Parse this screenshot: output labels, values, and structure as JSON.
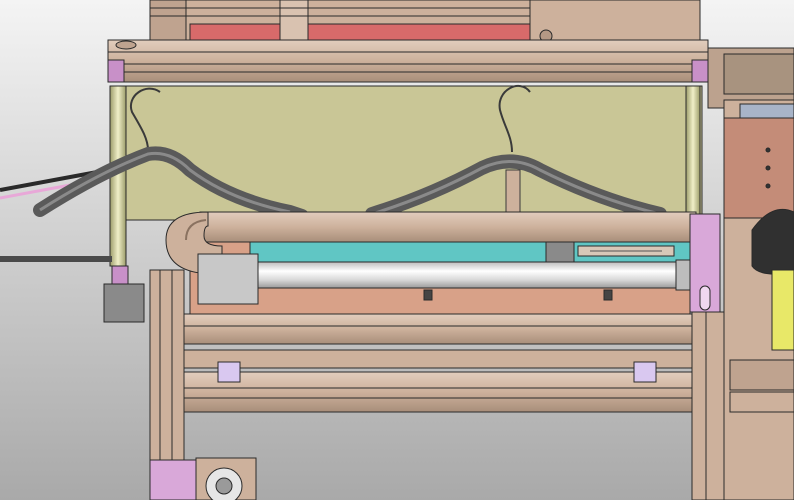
{
  "scene": {
    "subject": "cad-render",
    "palette": {
      "background_top": "#f4f4f4",
      "background_bottom": "#a9a9a9",
      "frame": "#cdb19c",
      "frame_dark": "#8a7260",
      "bracket": "#c890c8",
      "panel": "#c9c696",
      "rail": "#60c6c4",
      "hanger": "#707070",
      "roller": "#e8e8e8",
      "copper": "#d8a188",
      "red": "#d86a6a",
      "yellow": "#e8e868",
      "outline": "#2a2a2a"
    }
  }
}
